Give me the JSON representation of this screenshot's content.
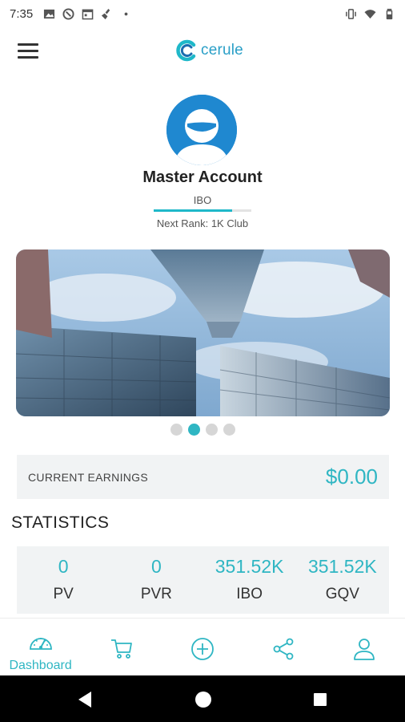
{
  "status_bar": {
    "time": "7:35",
    "left_icons": [
      "image-icon",
      "vpn-icon",
      "calendar-icon",
      "cleaning-icon",
      "dot-icon"
    ],
    "right_icons": [
      "vibrate-icon",
      "wifi-icon",
      "battery-icon"
    ]
  },
  "app_bar": {
    "logo_text": "cerule",
    "menu_icon": "hamburger-menu-icon"
  },
  "profile": {
    "name": "Master Account",
    "rank": "IBO",
    "rank_progress_percent": 80,
    "next_rank": "Next Rank: 1K Club"
  },
  "banner": {
    "slide_count": 4,
    "active_slide_index": 1
  },
  "earnings": {
    "label": "CURRENT EARNINGS",
    "value": "$0.00"
  },
  "statistics": {
    "title": "STATISTICS",
    "items": [
      {
        "value": "0",
        "label": "PV"
      },
      {
        "value": "0",
        "label": "PVR"
      },
      {
        "value": "351.52K",
        "label": "IBO"
      },
      {
        "value": "351.52K",
        "label": "GQV"
      }
    ]
  },
  "bottom_nav": {
    "items": [
      {
        "icon": "dashboard-gauge-icon",
        "label": "Dashboard",
        "active": true
      },
      {
        "icon": "cart-icon",
        "label": "",
        "active": false
      },
      {
        "icon": "plus-circle-icon",
        "label": "",
        "active": false
      },
      {
        "icon": "share-icon",
        "label": "",
        "active": false
      },
      {
        "icon": "user-icon",
        "label": "",
        "active": false
      }
    ]
  },
  "colors": {
    "accent": "#2fb6c3",
    "logo": "#2a9fc7",
    "avatar_bg": "#1f88d0",
    "panel_bg": "#f1f3f4"
  },
  "system_nav": {
    "buttons": [
      "back-icon",
      "home-icon",
      "recents-icon"
    ]
  }
}
